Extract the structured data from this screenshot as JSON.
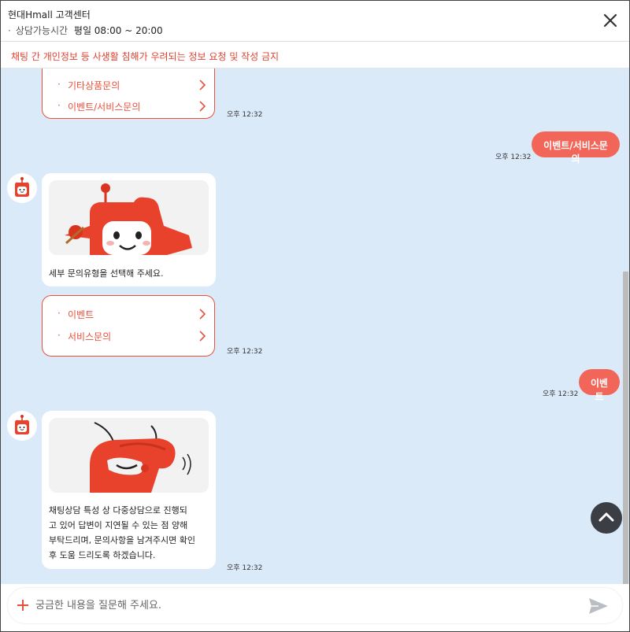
{
  "header": {
    "title": "현대Hmall 고객센터",
    "hours_bullet": "·",
    "hours_label": "상담가능시간",
    "hours_value": "평일 08:00 ~ 20:00"
  },
  "notice": "채팅 간 개인정보 등 사생활 침해가 우려되는 정보 요청 및 작성 금지",
  "chat": {
    "menu1": {
      "items": [
        "기타상품문의",
        "이벤트/서비스문의"
      ],
      "time": "오후 12:32"
    },
    "user1": {
      "text": "이벤트/서비스문의",
      "time": "오후 12:32"
    },
    "bot1": {
      "text": "세부 문의유형을 선택해 주세요."
    },
    "menu2": {
      "items": [
        "이벤트",
        "서비스문의"
      ],
      "time": "오후 12:32"
    },
    "user2": {
      "text": "이벤트",
      "time": "오후 12:32"
    },
    "bot2": {
      "lines": [
        "채팅상담 특성 상 다중상담으로 진행되",
        "고 있어 답변이 지연될 수 있는 점 양해",
        "부탁드리며, 문의사항을 남겨주시면 확인",
        "후 도움 드리도록 하겠습니다."
      ],
      "time": "오후 12:32"
    }
  },
  "input": {
    "placeholder": "궁금한 내용을 질문해 주세요.",
    "value": ""
  },
  "icons": {
    "close": "close-icon",
    "chevron": "chevron-right-icon",
    "avatar": "mascot-avatar-icon",
    "scroll_top": "chevron-up-icon",
    "plus": "plus-icon",
    "send": "send-icon"
  },
  "colors": {
    "accent": "#e8503a",
    "user_bubble": "#f2665a",
    "chat_background": "#dbeaf9",
    "notice_text": "#e0422f"
  }
}
